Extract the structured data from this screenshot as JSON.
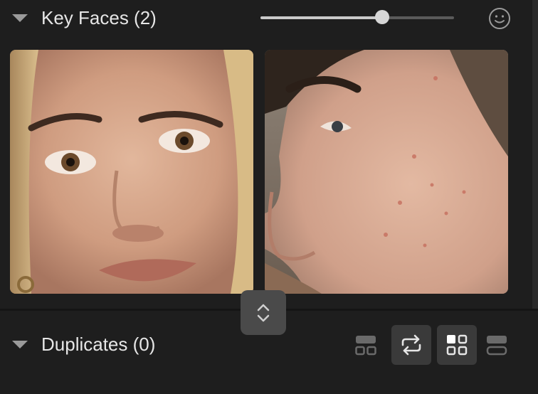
{
  "key_faces": {
    "title": "Key Faces (2)",
    "slider_value": 0.63,
    "face_icon": "smiley-face-icon",
    "faces": [
      {
        "name": "face-woman",
        "icon": "portrait-photo"
      },
      {
        "name": "face-man-profile",
        "icon": "portrait-photo"
      }
    ]
  },
  "duplicates": {
    "title": "Duplicates (0)"
  },
  "view_controls": {
    "buttons": [
      {
        "name": "layout-wide-grid-icon",
        "active": false
      },
      {
        "name": "swap-repeat-icon",
        "active": true
      },
      {
        "name": "grid-view-icon",
        "active": true
      },
      {
        "name": "list-view-icon",
        "active": false
      }
    ]
  },
  "colors": {
    "background": "#1e1e1e",
    "handle": "#4a4a4a",
    "active_button": "#3a3a3a",
    "text": "#e6e6e6"
  }
}
